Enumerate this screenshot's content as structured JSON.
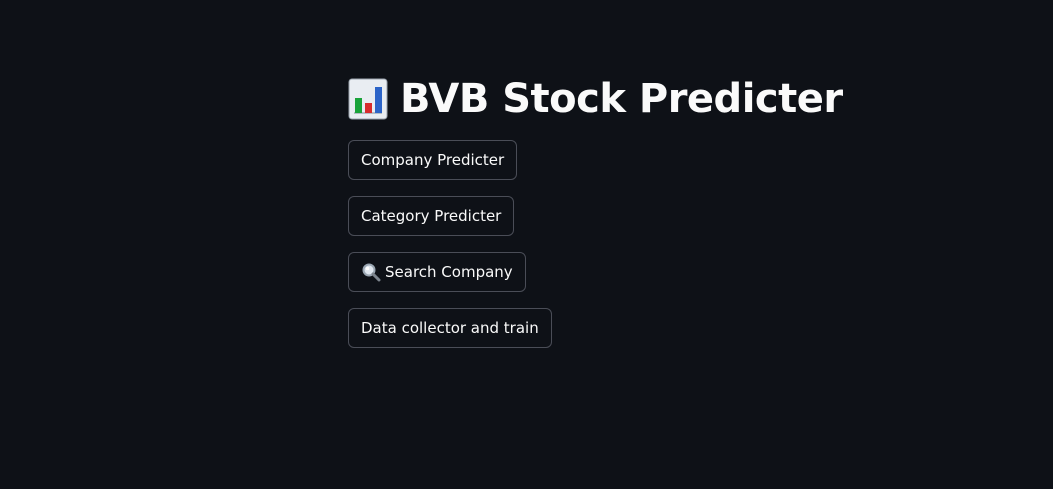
{
  "page": {
    "title": "BVB Stock Predicter",
    "title_icon": "bar-chart-icon",
    "background_color": "#0e1117",
    "text_color": "#fafafa",
    "button_border_color": "#4a4d57"
  },
  "buttons": {
    "company": {
      "label": "Company Predicter"
    },
    "category": {
      "label": "Category Predicter"
    },
    "search": {
      "label": "Search Company",
      "icon": "magnifying-glass-icon"
    },
    "data": {
      "label": "Data collector and train"
    }
  }
}
